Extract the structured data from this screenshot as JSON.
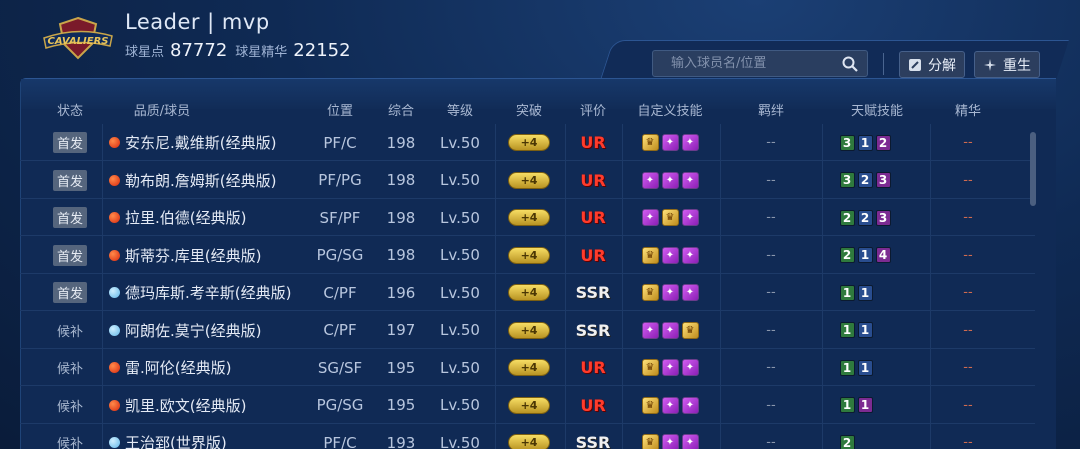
{
  "header": {
    "team_name": "Leader | mvp",
    "points_label": "球星点",
    "points_value": "87772",
    "essence_label": "球星精华",
    "essence_value": "22152"
  },
  "search": {
    "placeholder": "输入球员名/位置"
  },
  "buttons": {
    "decompose": "分解",
    "rebirth": "重生"
  },
  "columns": [
    "状态",
    "品质/球员",
    "位置",
    "综合",
    "等级",
    "突破",
    "评价",
    "自定义技能",
    "羁绊",
    "天赋技能",
    "精华"
  ],
  "players": [
    {
      "status": "首发",
      "dot": "red",
      "name": "安东尼.戴维斯(经典版)",
      "pos": "PF/C",
      "overall": "198",
      "level": "Lv.50",
      "breakthrough": "+4",
      "grade": "UR",
      "skills": [
        "gold",
        "purple",
        "purple"
      ],
      "bond": "--",
      "talents": [
        {
          "v": "3",
          "c": "g"
        },
        {
          "v": "1",
          "c": "b"
        },
        {
          "v": "2",
          "c": "p"
        }
      ],
      "essence": "--"
    },
    {
      "status": "首发",
      "dot": "red",
      "name": "勒布朗.詹姆斯(经典版)",
      "pos": "PF/PG",
      "overall": "198",
      "level": "Lv.50",
      "breakthrough": "+4",
      "grade": "UR",
      "skills": [
        "purple",
        "purple",
        "purple"
      ],
      "bond": "--",
      "talents": [
        {
          "v": "3",
          "c": "g"
        },
        {
          "v": "2",
          "c": "b"
        },
        {
          "v": "3",
          "c": "p"
        }
      ],
      "essence": "--"
    },
    {
      "status": "首发",
      "dot": "red",
      "name": "拉里.伯德(经典版)",
      "pos": "SF/PF",
      "overall": "198",
      "level": "Lv.50",
      "breakthrough": "+4",
      "grade": "UR",
      "skills": [
        "purple",
        "gold",
        "purple"
      ],
      "bond": "--",
      "talents": [
        {
          "v": "2",
          "c": "g"
        },
        {
          "v": "2",
          "c": "b"
        },
        {
          "v": "3",
          "c": "p"
        }
      ],
      "essence": "--"
    },
    {
      "status": "首发",
      "dot": "red",
      "name": "斯蒂芬.库里(经典版)",
      "pos": "PG/SG",
      "overall": "198",
      "level": "Lv.50",
      "breakthrough": "+4",
      "grade": "UR",
      "skills": [
        "gold",
        "purple",
        "purple"
      ],
      "bond": "--",
      "talents": [
        {
          "v": "2",
          "c": "g"
        },
        {
          "v": "1",
          "c": "b"
        },
        {
          "v": "4",
          "c": "p"
        }
      ],
      "essence": "--"
    },
    {
      "status": "首发",
      "dot": "blue",
      "name": "德玛库斯.考辛斯(经典版)",
      "pos": "C/PF",
      "overall": "196",
      "level": "Lv.50",
      "breakthrough": "+4",
      "grade": "SSR",
      "skills": [
        "gold",
        "purple",
        "purple"
      ],
      "bond": "--",
      "talents": [
        {
          "v": "1",
          "c": "g"
        },
        {
          "v": "1",
          "c": "b"
        }
      ],
      "essence": "--"
    },
    {
      "status": "候补",
      "dot": "blue",
      "name": "阿朗佐.莫宁(经典版)",
      "pos": "C/PF",
      "overall": "197",
      "level": "Lv.50",
      "breakthrough": "+4",
      "grade": "SSR",
      "skills": [
        "purple",
        "purple",
        "gold"
      ],
      "bond": "--",
      "talents": [
        {
          "v": "1",
          "c": "g"
        },
        {
          "v": "1",
          "c": "b"
        }
      ],
      "essence": "--"
    },
    {
      "status": "候补",
      "dot": "red",
      "name": "雷.阿伦(经典版)",
      "pos": "SG/SF",
      "overall": "195",
      "level": "Lv.50",
      "breakthrough": "+4",
      "grade": "UR",
      "skills": [
        "gold",
        "purple",
        "purple"
      ],
      "bond": "--",
      "talents": [
        {
          "v": "1",
          "c": "g"
        },
        {
          "v": "1",
          "c": "b"
        }
      ],
      "essence": "--"
    },
    {
      "status": "候补",
      "dot": "red",
      "name": "凯里.欧文(经典版)",
      "pos": "PG/SG",
      "overall": "195",
      "level": "Lv.50",
      "breakthrough": "+4",
      "grade": "UR",
      "skills": [
        "gold",
        "purple",
        "purple"
      ],
      "bond": "--",
      "talents": [
        {
          "v": "1",
          "c": "g"
        },
        {
          "v": "1",
          "c": "p"
        }
      ],
      "essence": "--"
    },
    {
      "status": "候补",
      "dot": "blue",
      "name": "王治郅(世界版)",
      "pos": "PF/C",
      "overall": "193",
      "level": "Lv.50",
      "breakthrough": "+4",
      "grade": "SSR",
      "skills": [
        "gold",
        "purple",
        "purple"
      ],
      "bond": "--",
      "talents": [
        {
          "v": "2",
          "c": "g"
        }
      ],
      "essence": "--"
    }
  ]
}
